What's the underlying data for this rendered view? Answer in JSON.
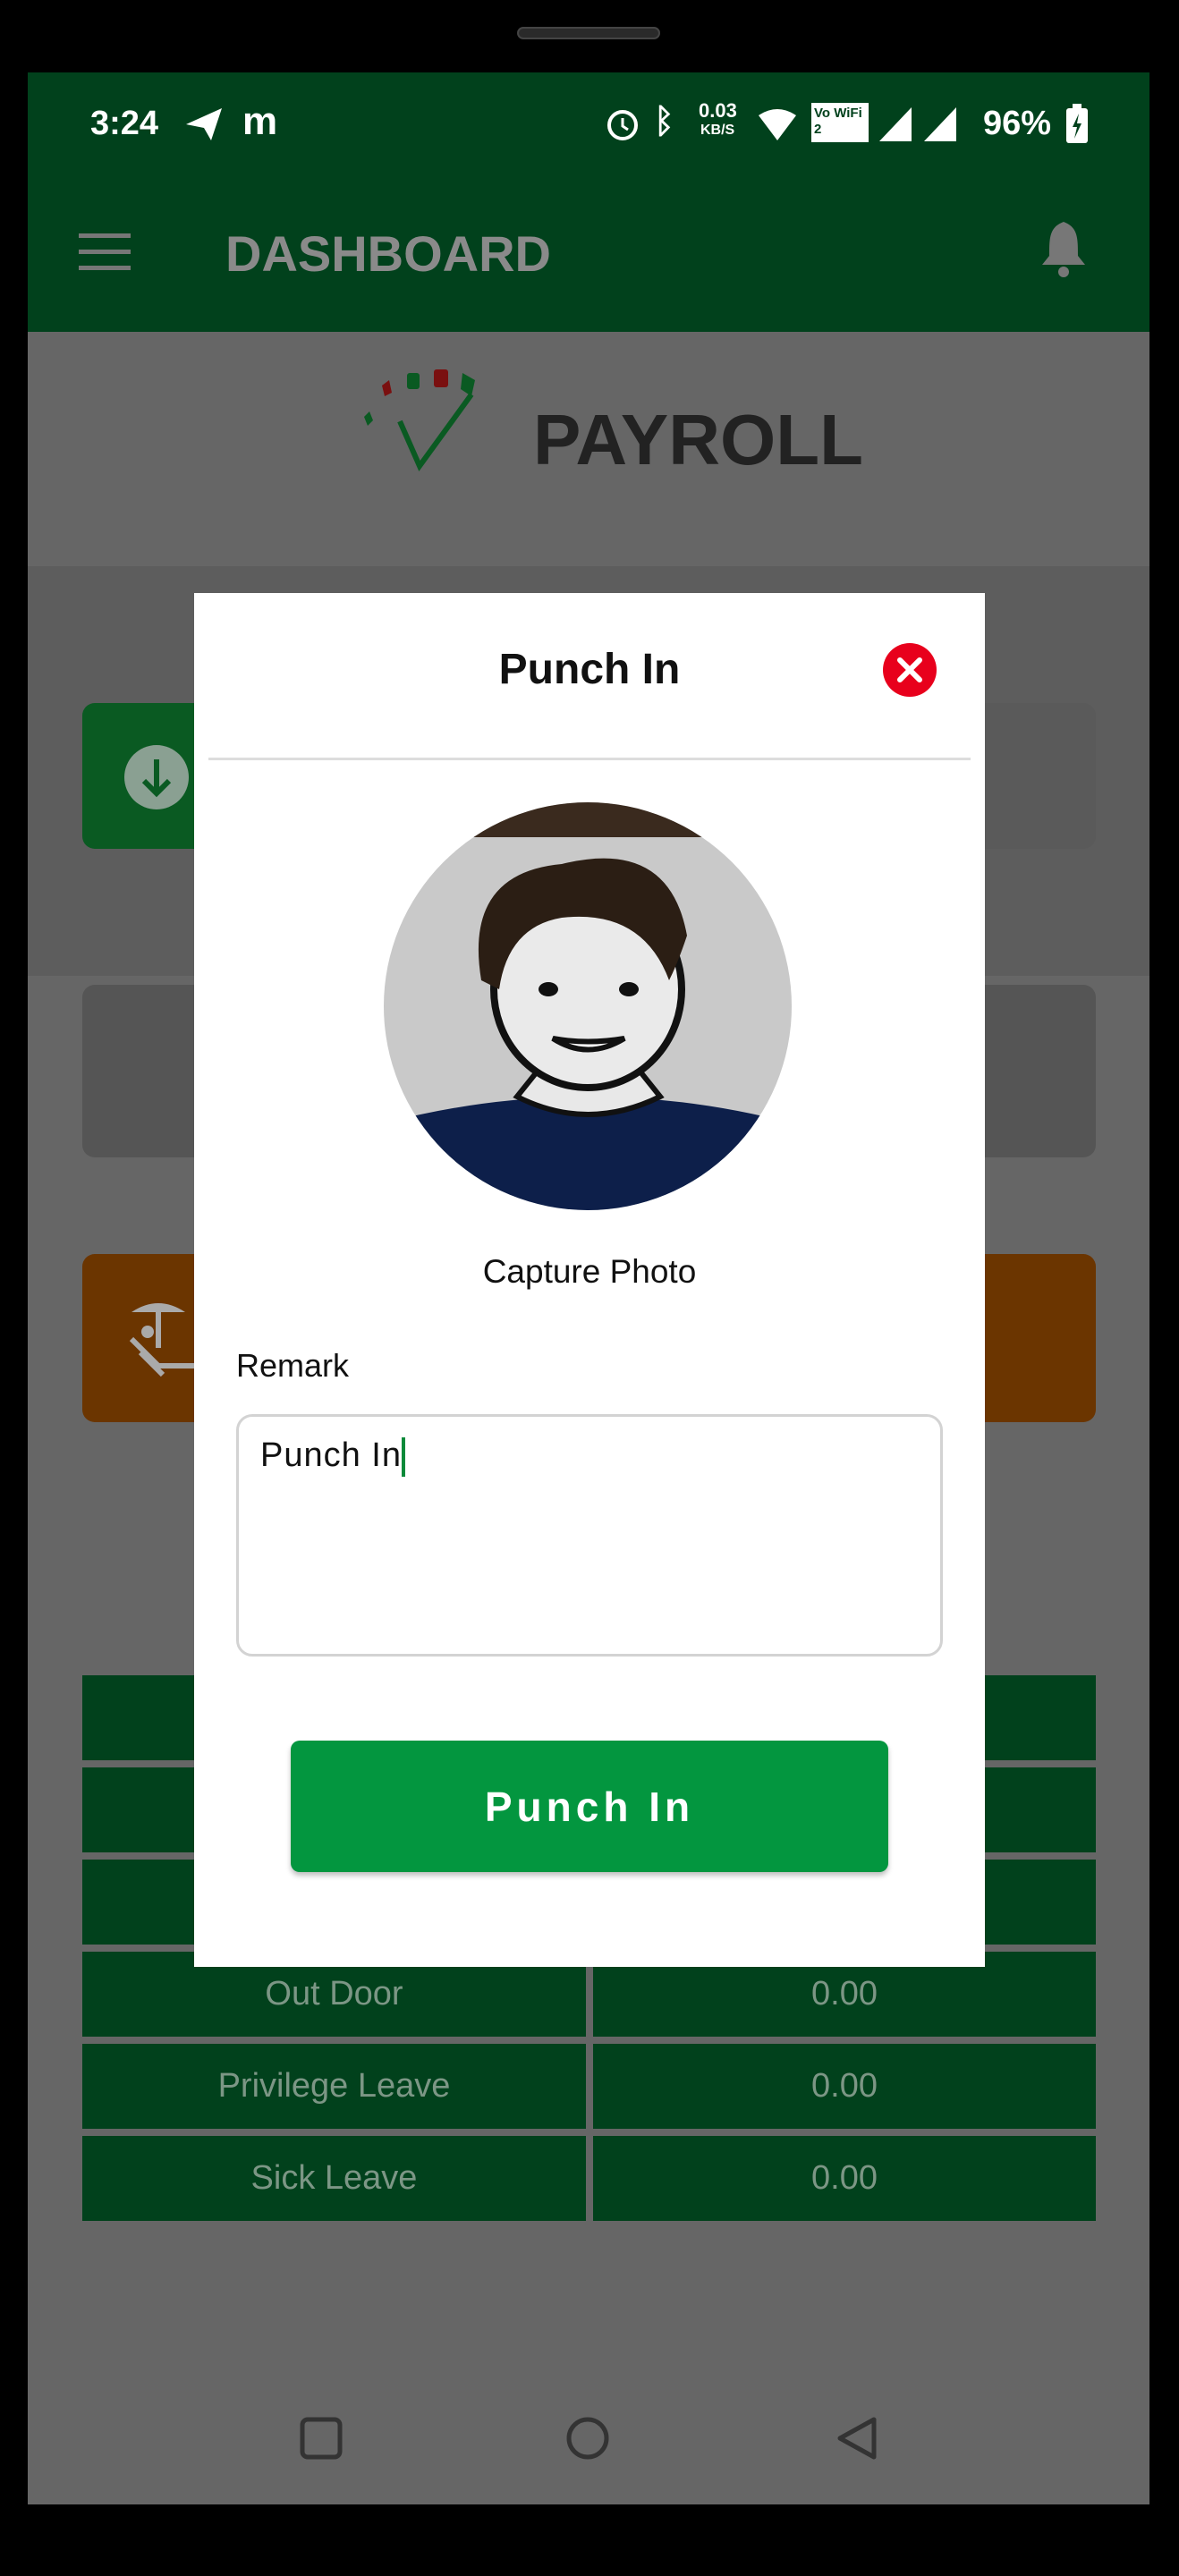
{
  "status_bar": {
    "time": "3:24",
    "net_speed": "0.03",
    "net_unit": "KB/S",
    "vowifi": "Vo WiFi 2",
    "battery": "96%"
  },
  "header": {
    "title": "DASHBOARD"
  },
  "logo": {
    "text": "PAYROLL"
  },
  "table": {
    "rows": [
      {
        "label": "",
        "value": ""
      },
      {
        "label": "",
        "value": ""
      },
      {
        "label": "",
        "value": ""
      },
      {
        "label": "Out Door",
        "value": "0.00"
      },
      {
        "label": "Privilege Leave",
        "value": "0.00"
      },
      {
        "label": "Sick Leave",
        "value": "0.00"
      }
    ]
  },
  "modal": {
    "title": "Punch In",
    "capture_label": "Capture Photo",
    "remark_label": "Remark",
    "remark_value": "Punch In",
    "submit_label": "Punch In"
  },
  "colors": {
    "header": "#01411c",
    "button": "#03963f",
    "close": "#e8001c",
    "leave_card": "#6b3500"
  }
}
